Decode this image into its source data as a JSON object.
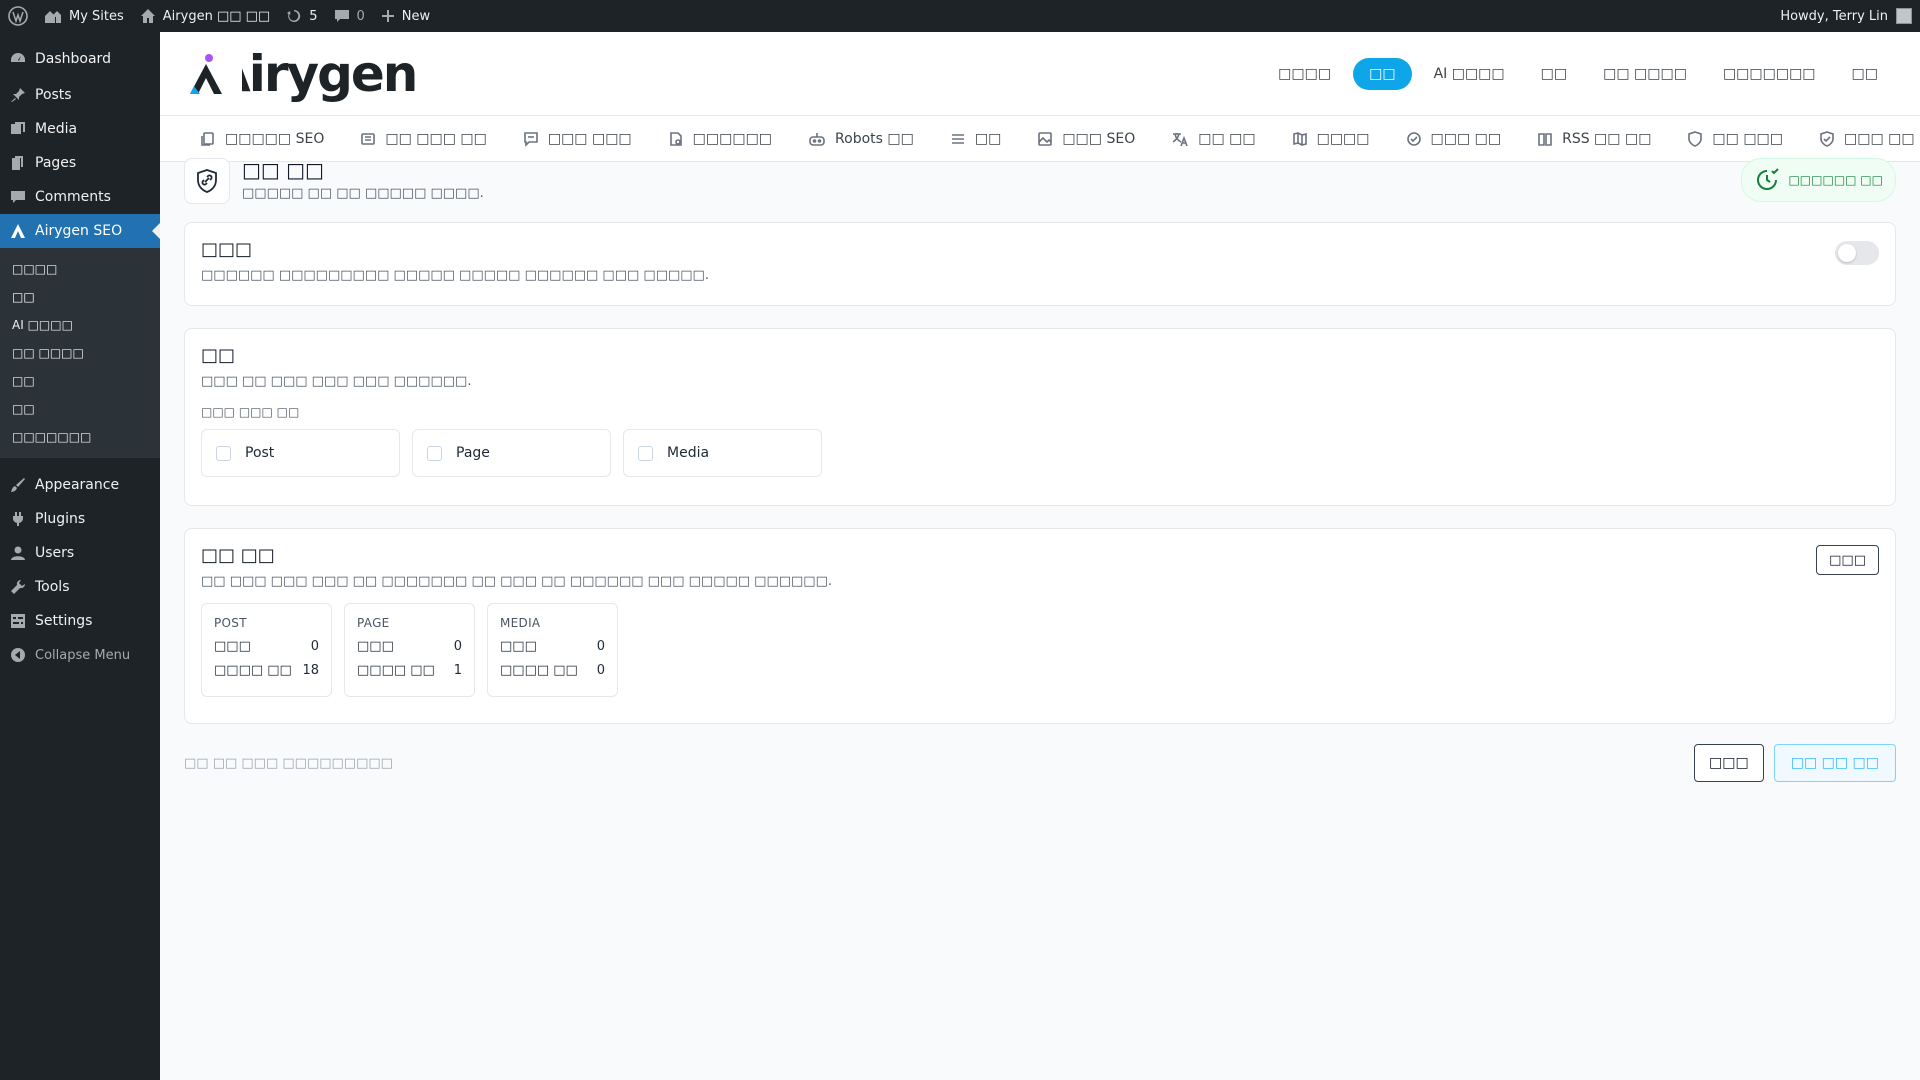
{
  "adminbar": {
    "my_sites": "My Sites",
    "site_name": "Airygen □□ □□",
    "updates_count": "5",
    "comments_count": "0",
    "new_label": "New",
    "howdy": "Howdy, Terry Lin"
  },
  "sidebar": {
    "items": [
      {
        "label": "Dashboard",
        "icon": "dashboard-icon"
      },
      {
        "label": "Posts",
        "icon": "pin-icon"
      },
      {
        "label": "Media",
        "icon": "media-icon"
      },
      {
        "label": "Pages",
        "icon": "pages-icon"
      },
      {
        "label": "Comments",
        "icon": "comment-icon"
      },
      {
        "label": "Airygen SEO",
        "icon": "airygen-icon"
      }
    ],
    "submenu": [
      "□□□□",
      "□□",
      "AI □□□□",
      "□□ □□□□",
      "□□",
      "□□",
      "□□□□□□□"
    ],
    "items2": [
      {
        "label": "Appearance",
        "icon": "brush-icon"
      },
      {
        "label": "Plugins",
        "icon": "plug-icon"
      },
      {
        "label": "Users",
        "icon": "user-icon"
      },
      {
        "label": "Tools",
        "icon": "wrench-icon"
      },
      {
        "label": "Settings",
        "icon": "settings-icon"
      }
    ],
    "collapse": "Collapse Menu"
  },
  "brand": {
    "logo_text": "Airygen",
    "accent": "#0ea5e9"
  },
  "topnav": [
    "□□□□",
    "□□",
    "AI □□□□",
    "□□",
    "□□ □□□□",
    "□□□□□□□",
    "□□"
  ],
  "subnav": [
    "□□□□□ SEO",
    "□□ □□□ □□",
    "□□□ □□□",
    "□□□□□□",
    "Robots □□",
    "□□",
    "□□□ SEO",
    "□□ □□",
    "□□□□",
    "□□□ □□",
    "RSS □□ □□",
    "□□ □□□",
    "□□□ □□ SEO",
    "..."
  ],
  "page": {
    "title": "□□ □□",
    "subtitle": "□□□□□ □□ □□ □□□□□ □□□□.",
    "status_pill": "□□□□□□ □□"
  },
  "card1": {
    "title": "□□□",
    "desc": "□□□□□□ □□□□□□□□□ □□□□□ □□□□□ □□□□□□ □□□ □□□□□."
  },
  "card2": {
    "title": "□□",
    "desc": "□□□ □□ □□□ □□□ □□□ □□□□□□.",
    "field_label": "□□□ □□□ □□",
    "options": [
      "Post",
      "Page",
      "Media"
    ]
  },
  "card3": {
    "title": "□□ □□",
    "desc": "□□ □□□ □□□ □□□ □□ □□□□□□□ □□ □□□ □□ □□□□□□ □□□ □□□□□ □□□□□□.",
    "refresh_button": "□□□",
    "stats": [
      {
        "head": "POST",
        "row1_label": "□□□",
        "row1_value": "0",
        "row2_label": "□□□□ □□",
        "row2_value": "18"
      },
      {
        "head": "PAGE",
        "row1_label": "□□□",
        "row1_value": "0",
        "row2_label": "□□□□ □□",
        "row2_value": "1"
      },
      {
        "head": "MEDIA",
        "row1_label": "□□□",
        "row1_value": "0",
        "row2_label": "□□□□ □□",
        "row2_value": "0"
      }
    ]
  },
  "footer": {
    "note": "□□ □□ □□□ □□□□□□□□□",
    "button1": "□□□",
    "button2": "□□ □□ □□"
  }
}
